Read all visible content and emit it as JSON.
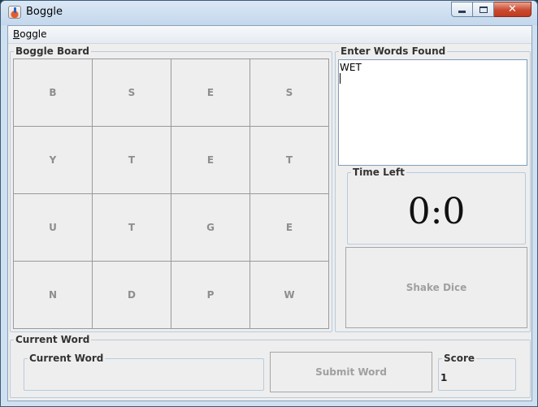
{
  "window": {
    "title": "Boggle"
  },
  "menu": {
    "items": [
      {
        "mnemonic": "B",
        "rest": "oggle"
      }
    ]
  },
  "board": {
    "title": "Boggle Board",
    "cells": [
      "B",
      "S",
      "E",
      "S",
      "Y",
      "T",
      "E",
      "T",
      "U",
      "T",
      "G",
      "E",
      "N",
      "D",
      "P",
      "W"
    ]
  },
  "words": {
    "title": "Enter Words Found",
    "text": "WET\n"
  },
  "timer": {
    "title": "Time Left",
    "value": "0:0"
  },
  "shake": {
    "label": "Shake Dice"
  },
  "current_word": {
    "outer_title": "Current Word",
    "inner_title": "Current Word",
    "value": ""
  },
  "submit": {
    "label": "Submit Word"
  },
  "score": {
    "title": "Score",
    "value": "1"
  }
}
